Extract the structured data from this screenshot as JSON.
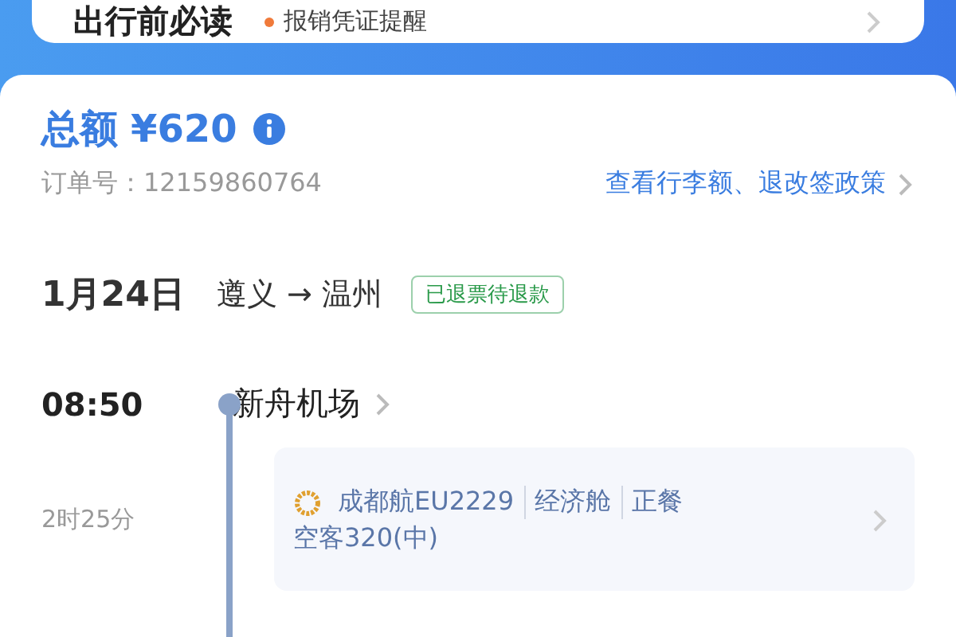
{
  "notice_card": {
    "title": "出行前必读",
    "item": "报销凭证提醒"
  },
  "order": {
    "total_label": "总额",
    "total_amount": "¥620",
    "order_no": "订单号：12159860764",
    "policy_link": "查看行李额、退改签政策"
  },
  "trip": {
    "date": "1月24日",
    "route": "遵义 → 温州",
    "status": "已退票待退款"
  },
  "departure": {
    "time": "08:50",
    "airport": "新舟机场"
  },
  "duration": "2时25分",
  "flight": {
    "tags": [
      "成都航EU2229",
      "经济舱",
      "正餐"
    ],
    "aircraft": "空客320(中)"
  }
}
